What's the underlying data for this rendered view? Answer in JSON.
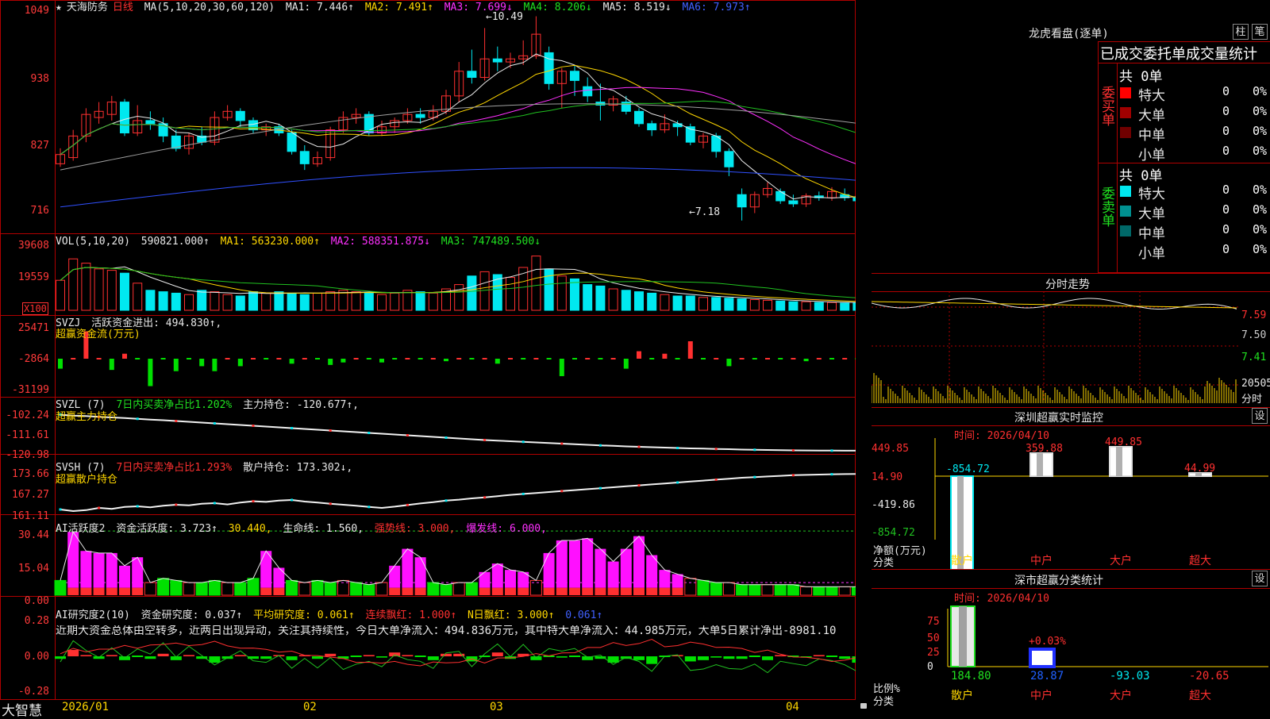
{
  "header": {
    "star": "★",
    "stock_name": "天海防务",
    "period": "日线",
    "ma_label": "MA(5,10,20,30,60,120)",
    "ma1": "MA1: 7.446↑",
    "ma2": "MA2: 7.491↑",
    "ma3": "MA3: 7.699↓",
    "ma4": "MA4: 8.206↓",
    "ma5": "MA5: 8.519↓",
    "ma6": "MA6: 7.973↑"
  },
  "price_pane": {
    "y_ticks": [
      "1049",
      "938",
      "827",
      "716"
    ],
    "high_label": "10.49",
    "low_label": "7.18"
  },
  "vol_pane": {
    "label": "VOL(5,10,20)",
    "value": "590821.000↑",
    "ma1": "MA1: 563230.000↑",
    "ma2": "MA2: 588351.875↓",
    "ma3": "MA3: 747489.500↓",
    "y_ticks": [
      "39608",
      "19559"
    ],
    "unit": "X100"
  },
  "svzj_pane": {
    "label": "SVZJ",
    "text1": "活跃资金进出: 494.830↑,",
    "text2": "超赢资金流(万元)",
    "y_ticks": [
      "25471",
      "-2864",
      "-31199"
    ]
  },
  "svzl_pane": {
    "label": "SVZL (7)",
    "text1": "7日内买卖净占比1.202%",
    "text2": "主力持仓: -120.677↑,",
    "text3": "超赢主力持仓",
    "y_ticks": [
      "-102.24",
      "-111.61",
      "-120.98"
    ]
  },
  "svsh_pane": {
    "label": "SVSH (7)",
    "text1": "7日内买卖净占比1.293%",
    "text2": "散户持仓: 173.302↓,",
    "text3": "超赢散户持仓",
    "y_ticks": [
      "173.66",
      "167.27",
      "161.11"
    ]
  },
  "ai1_pane": {
    "label": "AI活跃度2",
    "t1": "资金活跃度: 3.723↑",
    "t2": "30.440,",
    "t3": "生命线: 1.560,",
    "t4": "强势线: 3.000,",
    "t5": "爆发线: 6.000,",
    "y_ticks": [
      "30.44",
      "15.04",
      "0.00"
    ]
  },
  "ai2_pane": {
    "label": "AI研究度2(10)",
    "t1": "资金研究度: 0.037↑",
    "t2": "平均研究度: 0.061↑",
    "t3": "连续飘红: 1.000↑",
    "t4": "N日飘红: 3.000↑",
    "t5": "0.061↑",
    "comment": "近期大资金总体由空转多，近两日出现异动，关注其持续性，今日大单净流入：494.836万元，其中特大单净流入：44.985万元，大单5日累计净出-8981.10",
    "y_ticks": [
      "0.28",
      "0.00",
      "-0.28"
    ]
  },
  "bottom": {
    "brand": "大智慧",
    "dates": [
      "2026/01",
      "02",
      "03",
      "04"
    ]
  },
  "right": {
    "lh_title": "龙虎看盘(逐单)",
    "btn_col": "柱",
    "btn_bi": "笔",
    "order_title": "已成交委托单成交量统计",
    "buy_label": "委买单",
    "sell_label": "委卖单",
    "buy_total": "共 0单",
    "sell_total": "共 0单",
    "buy_rows": [
      {
        "name": "特大",
        "count": "0",
        "pct": "0%",
        "color": "#ff0000"
      },
      {
        "name": "大单",
        "count": "0",
        "pct": "0%",
        "color": "#a00000"
      },
      {
        "name": "中单",
        "count": "0",
        "pct": "0%",
        "color": "#700000"
      },
      {
        "name": "小单",
        "count": "0",
        "pct": "0%",
        "color": ""
      }
    ],
    "sell_rows": [
      {
        "name": "特大",
        "count": "0",
        "pct": "0%",
        "color": "#00e8f0"
      },
      {
        "name": "大单",
        "count": "0",
        "pct": "0%",
        "color": "#009090"
      },
      {
        "name": "中单",
        "count": "0",
        "pct": "0%",
        "color": "#006868"
      },
      {
        "name": "小单",
        "count": "0",
        "pct": "0%",
        "color": ""
      }
    ],
    "fs_title": "分时走势",
    "fs_ticks": [
      "7.59",
      "7.50",
      "7.41",
      "20505"
    ],
    "fs_unit": "分时",
    "sz_title": "深圳超赢实时监控",
    "sz_btn": "设",
    "sz_time": "时间: 2026/04/10",
    "sz_y_ticks": [
      "449.85",
      "14.90",
      "-419.86",
      "-854.72"
    ],
    "sz_ylabel": "净额(万元)",
    "sz_xlabel": "分类",
    "sz_categories": [
      "散户",
      "中户",
      "大户",
      "超大"
    ],
    "sz_values": [
      "-854.72",
      "359.88",
      "449.85",
      "44.99"
    ],
    "cls_title": "深市超赢分类统计",
    "cls_btn": "设",
    "cls_time": "时间: 2026/04/10",
    "cls_y_ticks": [
      "75",
      "50",
      "25",
      "0"
    ],
    "cls_ylabel": "比例%",
    "cls_xlabel": "分类",
    "cls_categories": [
      "散户",
      "中户",
      "大户",
      "超大"
    ],
    "cls_values": [
      "184.80",
      "28.87",
      "-93.03",
      "-20.65"
    ],
    "cls_mark": "+0.03%"
  },
  "chart_data": [
    {
      "type": "candlestick",
      "title": "天海防务 日线",
      "ylim": [
        7.05,
        10.6
      ],
      "y_ticks": [
        10.49,
        9.38,
        8.27,
        7.16
      ],
      "x_labels": [
        "2026/01",
        "02",
        "03",
        "04"
      ],
      "high": 10.49,
      "low": 7.18,
      "candles": [
        {
          "o": 8.1,
          "c": 8.25,
          "h": 8.35,
          "l": 8.05
        },
        {
          "o": 8.2,
          "c": 8.55,
          "h": 8.65,
          "l": 8.15
        },
        {
          "o": 8.55,
          "c": 8.9,
          "h": 9.0,
          "l": 8.45
        },
        {
          "o": 8.85,
          "c": 8.95,
          "h": 9.1,
          "l": 8.75
        },
        {
          "o": 8.9,
          "c": 9.1,
          "h": 9.2,
          "l": 8.8
        },
        {
          "o": 9.1,
          "c": 8.6,
          "h": 9.15,
          "l": 8.55
        },
        {
          "o": 8.6,
          "c": 8.8,
          "h": 9.05,
          "l": 8.55
        },
        {
          "o": 8.8,
          "c": 8.75,
          "h": 8.95,
          "l": 8.65
        },
        {
          "o": 8.75,
          "c": 8.55,
          "h": 8.85,
          "l": 8.45
        },
        {
          "o": 8.55,
          "c": 8.35,
          "h": 8.65,
          "l": 8.3
        },
        {
          "o": 8.35,
          "c": 8.55,
          "h": 8.6,
          "l": 8.25
        },
        {
          "o": 8.55,
          "c": 8.45,
          "h": 8.7,
          "l": 8.4
        },
        {
          "o": 8.45,
          "c": 8.85,
          "h": 8.95,
          "l": 8.4
        },
        {
          "o": 8.85,
          "c": 8.95,
          "h": 9.05,
          "l": 8.8
        },
        {
          "o": 8.95,
          "c": 8.8,
          "h": 9.0,
          "l": 8.7
        },
        {
          "o": 8.8,
          "c": 8.65,
          "h": 8.85,
          "l": 8.6
        },
        {
          "o": 8.65,
          "c": 8.7,
          "h": 8.75,
          "l": 8.55
        },
        {
          "o": 8.7,
          "c": 8.6,
          "h": 8.75,
          "l": 8.55
        },
        {
          "o": 8.6,
          "c": 8.3,
          "h": 8.65,
          "l": 8.25
        },
        {
          "o": 8.3,
          "c": 8.1,
          "h": 8.4,
          "l": 8.0
        },
        {
          "o": 8.1,
          "c": 8.2,
          "h": 8.3,
          "l": 8.05
        },
        {
          "o": 8.2,
          "c": 8.65,
          "h": 8.7,
          "l": 8.15
        },
        {
          "o": 8.65,
          "c": 8.85,
          "h": 8.95,
          "l": 8.6
        },
        {
          "o": 8.85,
          "c": 8.9,
          "h": 9.0,
          "l": 8.75
        },
        {
          "o": 8.9,
          "c": 8.6,
          "h": 8.95,
          "l": 8.55
        },
        {
          "o": 8.6,
          "c": 8.7,
          "h": 8.8,
          "l": 8.55
        },
        {
          "o": 8.7,
          "c": 8.8,
          "h": 8.85,
          "l": 8.6
        },
        {
          "o": 8.8,
          "c": 8.9,
          "h": 9.0,
          "l": 8.75
        },
        {
          "o": 8.9,
          "c": 8.85,
          "h": 9.0,
          "l": 8.75
        },
        {
          "o": 8.85,
          "c": 8.95,
          "h": 9.05,
          "l": 8.8
        },
        {
          "o": 8.95,
          "c": 9.2,
          "h": 9.3,
          "l": 8.9
        },
        {
          "o": 9.2,
          "c": 9.6,
          "h": 9.75,
          "l": 9.1
        },
        {
          "o": 9.6,
          "c": 9.5,
          "h": 9.95,
          "l": 9.4
        },
        {
          "o": 9.5,
          "c": 9.8,
          "h": 10.3,
          "l": 9.45
        },
        {
          "o": 9.8,
          "c": 9.75,
          "h": 10.0,
          "l": 9.6
        },
        {
          "o": 9.75,
          "c": 9.8,
          "h": 9.9,
          "l": 9.65
        },
        {
          "o": 9.8,
          "c": 9.85,
          "h": 10.1,
          "l": 9.7
        },
        {
          "o": 9.85,
          "c": 10.2,
          "h": 10.49,
          "l": 9.8
        },
        {
          "o": 9.9,
          "c": 9.4,
          "h": 10.0,
          "l": 9.3
        },
        {
          "o": 9.4,
          "c": 9.6,
          "h": 9.65,
          "l": 9.0
        },
        {
          "o": 9.6,
          "c": 9.45,
          "h": 9.7,
          "l": 9.2
        },
        {
          "o": 9.35,
          "c": 9.2,
          "h": 9.5,
          "l": 9.1
        },
        {
          "o": 9.1,
          "c": 9.05,
          "h": 9.4,
          "l": 8.8
        },
        {
          "o": 9.05,
          "c": 9.15,
          "h": 9.2,
          "l": 8.95
        },
        {
          "o": 9.1,
          "c": 8.95,
          "h": 9.2,
          "l": 8.9
        },
        {
          "o": 8.95,
          "c": 8.75,
          "h": 9.0,
          "l": 8.7
        },
        {
          "o": 8.75,
          "c": 8.65,
          "h": 8.8,
          "l": 8.55
        },
        {
          "o": 8.65,
          "c": 8.75,
          "h": 8.9,
          "l": 8.6
        },
        {
          "o": 8.75,
          "c": 8.7,
          "h": 8.8,
          "l": 8.55
        },
        {
          "o": 8.7,
          "c": 8.45,
          "h": 8.75,
          "l": 8.4
        },
        {
          "o": 8.45,
          "c": 8.55,
          "h": 8.6,
          "l": 8.35
        },
        {
          "o": 8.55,
          "c": 8.3,
          "h": 8.6,
          "l": 8.2
        },
        {
          "o": 8.3,
          "c": 8.05,
          "h": 8.35,
          "l": 7.9
        },
        {
          "o": 7.6,
          "c": 7.4,
          "h": 7.7,
          "l": 7.18
        },
        {
          "o": 7.4,
          "c": 7.6,
          "h": 7.65,
          "l": 7.3
        },
        {
          "o": 7.6,
          "c": 7.7,
          "h": 7.8,
          "l": 7.55
        },
        {
          "o": 7.65,
          "c": 7.5,
          "h": 7.7,
          "l": 7.45
        },
        {
          "o": 7.5,
          "c": 7.45,
          "h": 7.6,
          "l": 7.4
        },
        {
          "o": 7.45,
          "c": 7.58,
          "h": 7.62,
          "l": 7.4
        },
        {
          "o": 7.58,
          "c": 7.55,
          "h": 7.65,
          "l": 7.5
        },
        {
          "o": 7.55,
          "c": 7.65,
          "h": 7.72,
          "l": 7.5
        },
        {
          "o": 7.6,
          "c": 7.55,
          "h": 7.7,
          "l": 7.5
        },
        {
          "o": 7.55,
          "c": 7.5,
          "h": 7.62,
          "l": 7.45
        },
        {
          "o": 7.5,
          "c": 7.3,
          "h": 7.55,
          "l": 7.28
        },
        {
          "o": 7.3,
          "c": 7.38,
          "h": 7.45,
          "l": 7.25
        },
        {
          "o": 7.38,
          "c": 7.6,
          "h": 7.65,
          "l": 7.35
        },
        {
          "o": 7.6,
          "c": 7.55,
          "h": 7.63,
          "l": 7.48
        },
        {
          "o": 7.55,
          "c": 7.58,
          "h": 7.62,
          "l": 7.5
        }
      ]
    },
    {
      "type": "bar",
      "title": "VOL(5,10,20)",
      "ylim": [
        0,
        45000
      ],
      "y_ticks": [
        39608,
        19559
      ],
      "values": [
        21000,
        36000,
        33000,
        29000,
        28000,
        26000,
        19000,
        14000,
        13000,
        12000,
        11000,
        14000,
        13000,
        11000,
        10000,
        13000,
        12000,
        13000,
        12000,
        11000,
        12000,
        13000,
        14000,
        13000,
        12000,
        11000,
        12000,
        14000,
        13000,
        12000,
        15000,
        18000,
        24000,
        27000,
        25000,
        23000,
        30000,
        38000,
        29000,
        24000,
        22000,
        18000,
        17000,
        15000,
        14000,
        13000,
        12000,
        11000,
        10000,
        10000,
        9000,
        9000,
        8500,
        8000,
        7500,
        7000,
        6500,
        6000,
        6000,
        5500,
        5500,
        5000,
        5200,
        5000,
        5100,
        5000,
        4800,
        5900
      ]
    },
    {
      "type": "bar",
      "title": "SVZJ 超赢资金流(万元)",
      "ylim": [
        -31199,
        25471
      ],
      "y_ticks": [
        25471,
        -2864,
        -31199
      ],
      "values": [
        -8000,
        0,
        22000,
        0,
        -9000,
        4000,
        0,
        -22000,
        0,
        -10000,
        0,
        -6000,
        -10000,
        0,
        -6000,
        0,
        0,
        0,
        -4000,
        0,
        0,
        -5000,
        -3000,
        0,
        0,
        -3000,
        0,
        0,
        0,
        0,
        -2000,
        0,
        0,
        0,
        -4000,
        0,
        0,
        0,
        0,
        -14000,
        0,
        0,
        0,
        0,
        -8000,
        6000,
        0,
        4000,
        0,
        14000,
        0,
        0,
        -6000,
        0,
        0,
        0,
        0,
        0,
        -2000,
        0,
        0,
        0,
        0,
        0,
        0,
        0,
        0,
        -1000
      ]
    },
    {
      "type": "line",
      "title": "SVZL 超赢主力持仓",
      "ylim": [
        -121.5,
        -101.5
      ],
      "y_ticks": [
        -102.24,
        -111.61,
        -120.98
      ],
      "values": [
        -102.5,
        -103.0,
        -103.2,
        -103.6,
        -103.9,
        -104.2,
        -104.6,
        -105.0,
        -105.3,
        -105.7,
        -106.1,
        -106.5,
        -106.9,
        -107.3,
        -107.7,
        -108.1,
        -108.5,
        -108.9,
        -109.3,
        -109.7,
        -110.1,
        -110.5,
        -110.9,
        -111.3,
        -111.7,
        -112.1,
        -112.5,
        -112.9,
        -113.3,
        -113.7,
        -114.1,
        -114.5,
        -114.9,
        -115.3,
        -115.6,
        -115.9,
        -116.2,
        -116.5,
        -116.8,
        -117.1,
        -117.4,
        -117.7,
        -118.0,
        -118.2,
        -118.5,
        -118.7,
        -118.9,
        -119.1,
        -119.3,
        -119.5,
        -119.6,
        -119.8,
        -119.9,
        -120.1,
        -120.2,
        -120.3,
        -120.4,
        -120.5,
        -120.55,
        -120.6,
        -120.62,
        -120.65,
        -120.66,
        -120.67,
        -120.67,
        -120.67,
        -120.677
      ]
    },
    {
      "type": "line",
      "title": "SVSH 超赢散户持仓",
      "ylim": [
        160.5,
        174.5
      ],
      "y_ticks": [
        173.66,
        167.27,
        161.11
      ],
      "values": [
        162.0,
        161.5,
        161.8,
        162.5,
        162.2,
        162.8,
        163.0,
        162.7,
        163.2,
        163.5,
        163.3,
        163.8,
        164.0,
        163.6,
        164.2,
        164.6,
        164.4,
        164.8,
        165.0,
        164.5,
        164.2,
        163.8,
        163.5,
        163.2,
        162.8,
        162.5,
        162.9,
        163.4,
        163.9,
        164.3,
        164.8,
        165.1,
        165.5,
        165.8,
        166.2,
        166.6,
        166.9,
        167.2,
        167.5,
        167.8,
        168.1,
        168.4,
        168.7,
        169.0,
        169.3,
        169.6,
        169.9,
        170.2,
        170.5,
        170.8,
        171.1,
        171.4,
        171.7,
        172.0,
        172.2,
        172.4,
        172.6,
        172.8,
        172.9,
        173.0,
        173.1,
        173.15,
        173.2,
        173.25,
        173.28,
        173.3,
        173.302
      ]
    },
    {
      "type": "bar",
      "title": "AI活跃度2",
      "ylim": [
        0,
        32
      ],
      "y_ticks": [
        30.44,
        15.04,
        0.0
      ],
      "values": [
        7,
        30,
        21,
        20,
        20,
        14,
        18,
        6,
        8,
        7,
        6,
        6,
        7,
        6,
        6,
        8,
        21,
        13,
        7,
        6,
        7,
        6,
        7,
        6,
        5,
        6,
        14,
        22,
        18,
        6,
        5,
        6,
        6,
        11,
        15,
        12,
        11,
        7,
        20,
        26,
        26,
        27,
        22,
        16,
        22,
        28,
        19,
        12,
        10,
        8,
        7,
        6,
        6,
        5,
        5,
        5,
        5,
        5,
        4,
        4,
        4,
        4,
        4,
        4,
        4,
        4,
        4,
        4
      ]
    },
    {
      "type": "bar",
      "title": "AI研究度2(10)",
      "ylim": [
        -0.28,
        0.28
      ],
      "y_ticks": [
        0.28,
        0.0,
        -0.28
      ],
      "values": [
        -0.02,
        0.05,
        0.01,
        -0.02,
        0.01,
        -0.03,
        0.0,
        -0.02,
        0.02,
        -0.03,
        0.01,
        -0.02,
        -0.05,
        -0.02,
        0.01,
        -0.02,
        -0.02,
        0.01,
        -0.03,
        0.01,
        -0.02,
        0.02,
        -0.02,
        0.0,
        0.01,
        -0.01,
        0.03,
        0.01,
        0.0,
        -0.03,
        0.02,
        0.02,
        -0.04,
        0.0,
        0.03,
        -0.02,
        0.02,
        -0.03,
        0.0,
        -0.01,
        0.0,
        -0.03,
        -0.02,
        -0.05,
        -0.02,
        -0.03,
        -0.06,
        0.0,
        0.01,
        -0.04,
        -0.03,
        -0.01,
        -0.02,
        -0.02,
        0.0,
        -0.03,
        0.01,
        0.0,
        -0.01,
        0.01,
        0.0,
        -0.02,
        -0.05,
        -0.03,
        0.0,
        -0.01,
        0.02,
        0.02
      ]
    }
  ]
}
